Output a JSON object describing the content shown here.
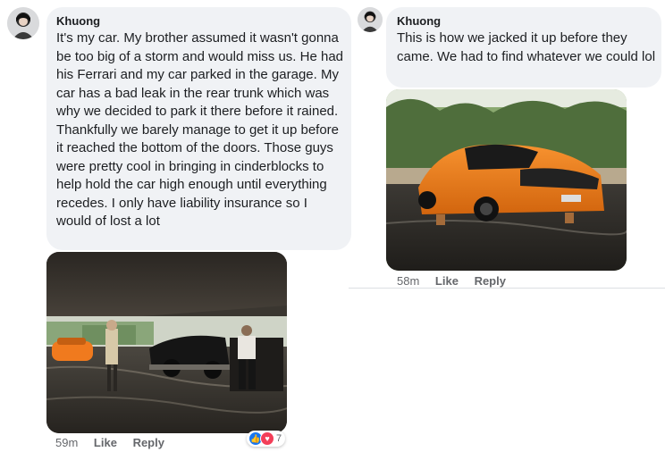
{
  "comment_left": {
    "author": "Khuong",
    "text": "It's my car. My brother assumed it wasn't gonna be too big of a storm and would miss us. He had his Ferrari and my car parked in the garage. My car has a bad leak in the rear trunk which was why we decided to park it there before it rained. Thankfully we barely manage to get it up before it reached the bottom of the doors. Those guys were pretty cool in bringing in cinderblocks to help hold the car high enough until everything recedes. I only have liability insurance so I would of lost a lot",
    "time": "59m",
    "like": "Like",
    "reply": "Reply",
    "reaction_count": "7",
    "reaction_icons": [
      "like-icon",
      "love-icon"
    ]
  },
  "comment_right": {
    "author": "Khuong",
    "text": "This is how we jacked it up before they came. We had to find whatever we could lol",
    "time": "58m",
    "like": "Like",
    "reply": "Reply"
  },
  "colors": {
    "bubble": "#f0f2f5",
    "meta": "#65676b",
    "like_blue": "#1877f2",
    "love_red": "#f33e58",
    "car_orange": "#f07a1e"
  }
}
